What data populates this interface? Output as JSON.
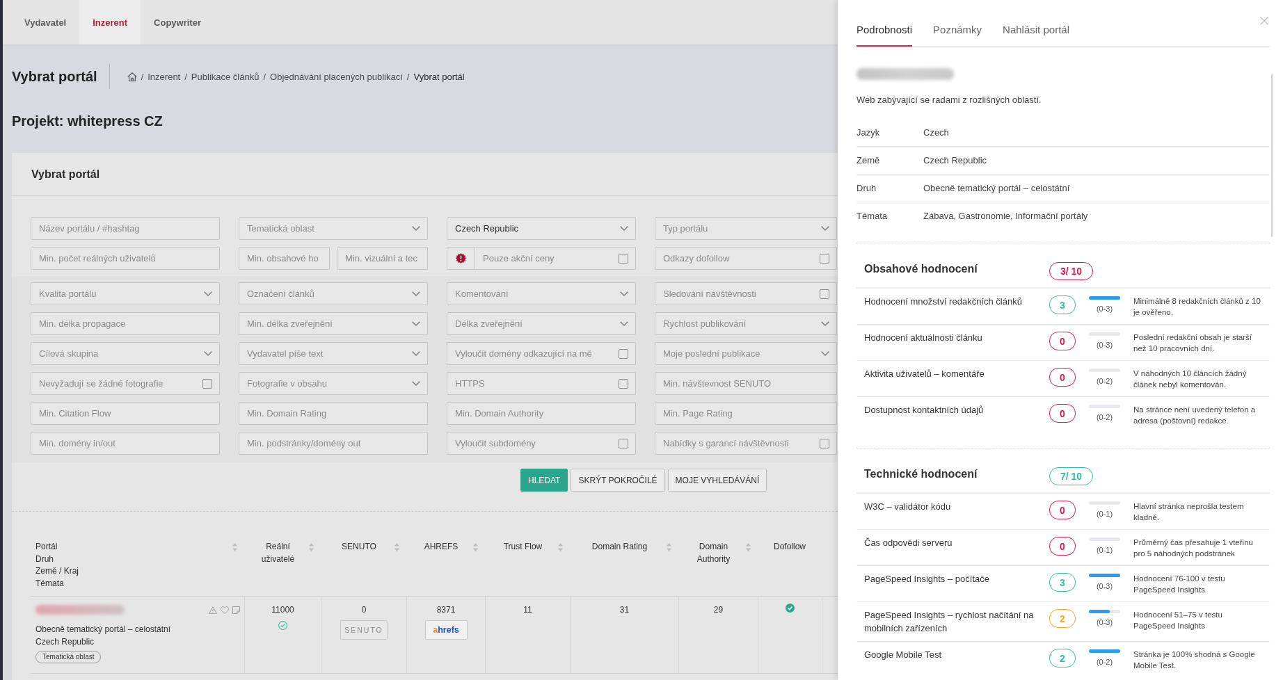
{
  "top_nav": {
    "tabs": [
      {
        "label": "Vydavatel",
        "selected": false
      },
      {
        "label": "Inzerent",
        "selected": true
      },
      {
        "label": "Copywriter",
        "selected": false
      }
    ]
  },
  "page_header": {
    "title": "Vybrat portál",
    "breadcrumb": {
      "separator": "/",
      "items": [
        "Inzerent",
        "Publikace článků",
        "Objednávání placených publikací",
        "Vybrat portál"
      ]
    }
  },
  "project_title": "Projekt: whitepress CZ",
  "search_card": {
    "title": "Vybrat portál",
    "basic_filters": [
      {
        "kind": "text",
        "placeholder": "Název portálu / #hashtag"
      },
      {
        "kind": "select",
        "placeholder": "Tematická oblast"
      },
      {
        "kind": "select",
        "value": "Czech Republic"
      },
      {
        "kind": "select",
        "placeholder": "Typ portálu"
      },
      {
        "kind": "text",
        "placeholder": "Min. počet reálných uživatelů"
      },
      {
        "kind": "split",
        "placeholders": [
          "Min. obsahové ho",
          "Min. vizuální a tec"
        ]
      },
      {
        "kind": "promo",
        "label": "Pouze akční ceny",
        "checked": false
      },
      {
        "kind": "checkbox",
        "label": "Odkazy dofollow",
        "checked": false
      }
    ],
    "advanced_filters": [
      {
        "kind": "select",
        "placeholder": "Kvalita portálu"
      },
      {
        "kind": "select",
        "placeholder": "Označení článků"
      },
      {
        "kind": "select",
        "placeholder": "Komentování"
      },
      {
        "kind": "checkbox",
        "label": "Sledování návštěvnosti",
        "checked": false
      },
      {
        "kind": "text",
        "placeholder": "Min. délka propagace"
      },
      {
        "kind": "select",
        "placeholder": "Min. délka zveřejnění"
      },
      {
        "kind": "select",
        "placeholder": "Délka zveřejnění"
      },
      {
        "kind": "select",
        "placeholder": "Rychlost publikování"
      },
      {
        "kind": "select",
        "placeholder": "Cílová skupina"
      },
      {
        "kind": "select",
        "placeholder": "Vydavatel píše text"
      },
      {
        "kind": "checkbox",
        "label": "Vyloučit domény odkazující na mě",
        "checked": false
      },
      {
        "kind": "select",
        "placeholder": "Moje poslední publikace"
      },
      {
        "kind": "checkbox",
        "label": "Nevyžadují se žádné fotografie",
        "checked": false
      },
      {
        "kind": "select",
        "placeholder": "Fotografie v obsahu"
      },
      {
        "kind": "checkbox",
        "label": "HTTPS",
        "checked": false
      },
      {
        "kind": "text",
        "placeholder": "Min. návštevnost SENUTO"
      },
      {
        "kind": "text",
        "placeholder": "Min. Citation Flow"
      },
      {
        "kind": "text",
        "placeholder": "Min. Domain Rating"
      },
      {
        "kind": "text",
        "placeholder": "Min. Domain Authority"
      },
      {
        "kind": "text",
        "placeholder": "Min. Page Rating"
      },
      {
        "kind": "text",
        "placeholder": "Min. domény in/out"
      },
      {
        "kind": "text",
        "placeholder": "Min. podstránky/domény out"
      },
      {
        "kind": "checkbox",
        "label": "Vyloučit subdomény",
        "checked": false
      },
      {
        "kind": "checkbox",
        "label": "Nabídky s garancí návštěvnosti",
        "checked": false
      }
    ],
    "buttons": [
      {
        "label": "HLEDAT",
        "kind": "primary"
      },
      {
        "label": "SKRÝT POKROČILÉ",
        "kind": "secondary"
      },
      {
        "label": "MOJE VYHLEDÁVÁNÍ",
        "kind": "secondary"
      }
    ]
  },
  "table": {
    "columns": [
      {
        "labels": [
          "Portál",
          "Druh",
          "Země / Kraj",
          "Témata"
        ],
        "sortable": true
      },
      {
        "labels": [
          "Reální uživatelé"
        ],
        "sortable": true
      },
      {
        "labels": [
          "SENUTO"
        ],
        "sortable": true
      },
      {
        "labels": [
          "AHREFS"
        ],
        "sortable": true
      },
      {
        "labels": [
          "Trust Flow"
        ],
        "sortable": true
      },
      {
        "labels": [
          "Domain Rating"
        ],
        "sortable": true
      },
      {
        "labels": [
          "Domain Authority"
        ],
        "sortable": true
      },
      {
        "labels": [
          "Dofollow"
        ],
        "sortable": false
      }
    ],
    "rows": [
      {
        "type": "Obecně tematický portál – celostátní",
        "country": "Czech Republic",
        "tag": "Tematická oblast",
        "users": "11000",
        "users_verified": true,
        "senuto": "0",
        "senuto_logo": "SENUTO",
        "ahrefs": "8371",
        "ahrefs_logo": "ahrefs",
        "trust_flow": "11",
        "domain_rating": "31",
        "domain_authority": "29",
        "dofollow": true
      }
    ]
  },
  "detail_panel": {
    "tabs": [
      {
        "label": "Podrobnosti",
        "selected": true
      },
      {
        "label": "Poznámky",
        "selected": false
      },
      {
        "label": "Nahlásit portál",
        "selected": false
      }
    ],
    "description": "Web zabývající se radami z rozlišných oblastí.",
    "info": [
      {
        "label": "Jazyk",
        "value": "Czech"
      },
      {
        "label": "Země",
        "value": "Czech Republic"
      },
      {
        "label": "Druh",
        "value": "Obecně tematický portál – celostátní"
      },
      {
        "label": "Témata",
        "value": "Zábava, Gastronomie, Informační portály"
      }
    ],
    "sections": [
      {
        "title": "Obsahové hodnocení",
        "total": "3/ 10",
        "color": "#d81b4b",
        "criteria": [
          {
            "name": "Hodnocení množství redakčních článků",
            "score": "3",
            "color": "#2bbf9f",
            "level": 1,
            "range": "(0-3)",
            "note": "Minimálně 8 redakčních článků z 10 je ověřeno."
          },
          {
            "name": "Hodnocení aktuálnosti článku",
            "score": "0",
            "color": "#d81b4b",
            "level": 0,
            "range": "(0-3)",
            "note": "Poslední redakční obsah je starší než 10 pracovních dní."
          },
          {
            "name": "Aktivita uživatelů – komentáře",
            "score": "0",
            "color": "#d81b4b",
            "level": 0,
            "range": "(0-2)",
            "note": "V náhodných 10 článcích žádný článek nebyl komentován."
          },
          {
            "name": "Dostupnost kontaktních údajů",
            "score": "0",
            "color": "#d81b4b",
            "level": 0,
            "range": "(0-2)",
            "note": "Na stránce není uvedený telefon a adresa (poštovní) redakce."
          }
        ]
      },
      {
        "title": "Technické hodnocení",
        "total": "7/ 10",
        "color": "#2bbf9f",
        "criteria": [
          {
            "name": "W3C – validátor kódu",
            "score": "0",
            "color": "#d81b4b",
            "level": 0,
            "range": "(0-1)",
            "note": "Hlavní stránka neprošla testem kladně."
          },
          {
            "name": "Čas odpovědi serveru",
            "score": "0",
            "color": "#d81b4b",
            "level": 0,
            "range": "(0-1)",
            "note": "Průměrný čas přesahuje 1 vteřinu pro 5 náhodných podstránek"
          },
          {
            "name": "PageSpeed Insights – počítače",
            "score": "3",
            "color": "#2bbf9f",
            "level": 1,
            "range": "(0-3)",
            "note": "Hodnocení 76-100 v testu PageSpeed Insights"
          },
          {
            "name": "PageSpeed Insights – rychlost načítání na mobilních zařízeních",
            "score": "2",
            "color": "#f5a623",
            "level": 0.67,
            "range": "(0-3)",
            "note": "Hodnocení 51–75 v testu PageSpeed Insights"
          },
          {
            "name": "Google Mobile Test",
            "score": "2",
            "color": "#2bbf9f",
            "level": 1,
            "range": "(0-2)",
            "note": "Stránka je 100% shodná s Google Mobile Test."
          }
        ]
      }
    ]
  }
}
